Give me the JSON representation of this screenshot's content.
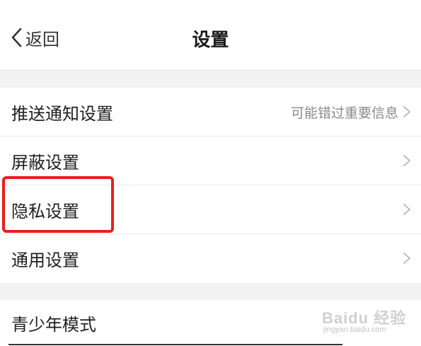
{
  "header": {
    "back_label": "返回",
    "title": "设置"
  },
  "settings_group_1": [
    {
      "label": "推送通知设置",
      "value": "可能错过重要信息"
    },
    {
      "label": "屏蔽设置",
      "value": ""
    },
    {
      "label": "隐私设置",
      "value": ""
    },
    {
      "label": "通用设置",
      "value": ""
    }
  ],
  "settings_group_2": [
    {
      "label": "青少年模式"
    }
  ],
  "watermark": {
    "brand": "Baidu 经验",
    "url": "jingyan.baidu.com"
  },
  "colors": {
    "highlight": "#ee1c1c",
    "background": "#f2f2f2",
    "secondary_text": "#8a8a8a"
  },
  "highlighted_item": "隐私设置"
}
